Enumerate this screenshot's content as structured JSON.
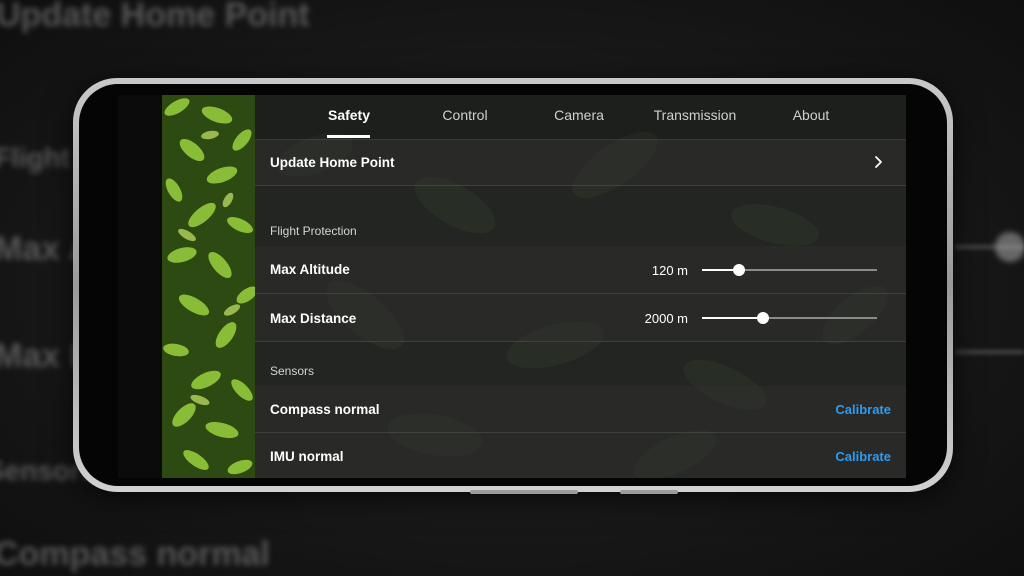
{
  "background_ghost": {
    "title": "Update Home Point",
    "flight": "Flight Pr",
    "altitude": "Max Al",
    "distance": "Max Di",
    "sensors": "Sensors",
    "compass": "Compass normal"
  },
  "tabs": [
    {
      "label": "Safety",
      "active": true
    },
    {
      "label": "Control",
      "active": false
    },
    {
      "label": "Camera",
      "active": false
    },
    {
      "label": "Transmission",
      "active": false
    },
    {
      "label": "About",
      "active": false
    }
  ],
  "update_home_point": {
    "label": "Update Home Point",
    "icon": "chevron-right-icon"
  },
  "flight_protection": {
    "header": "Flight Protection",
    "max_altitude": {
      "label": "Max Altitude",
      "value": "120 m",
      "slider_fraction": 0.21
    },
    "max_distance": {
      "label": "Max Distance",
      "value": "2000 m",
      "slider_fraction": 0.35
    }
  },
  "sensors": {
    "header": "Sensors",
    "compass": {
      "label": "Compass normal",
      "action": "Calibrate"
    },
    "imu": {
      "label": "IMU normal",
      "action": "Calibrate"
    }
  },
  "colors": {
    "accent_blue": "#2d9bf0",
    "text_white": "#ffffff"
  }
}
